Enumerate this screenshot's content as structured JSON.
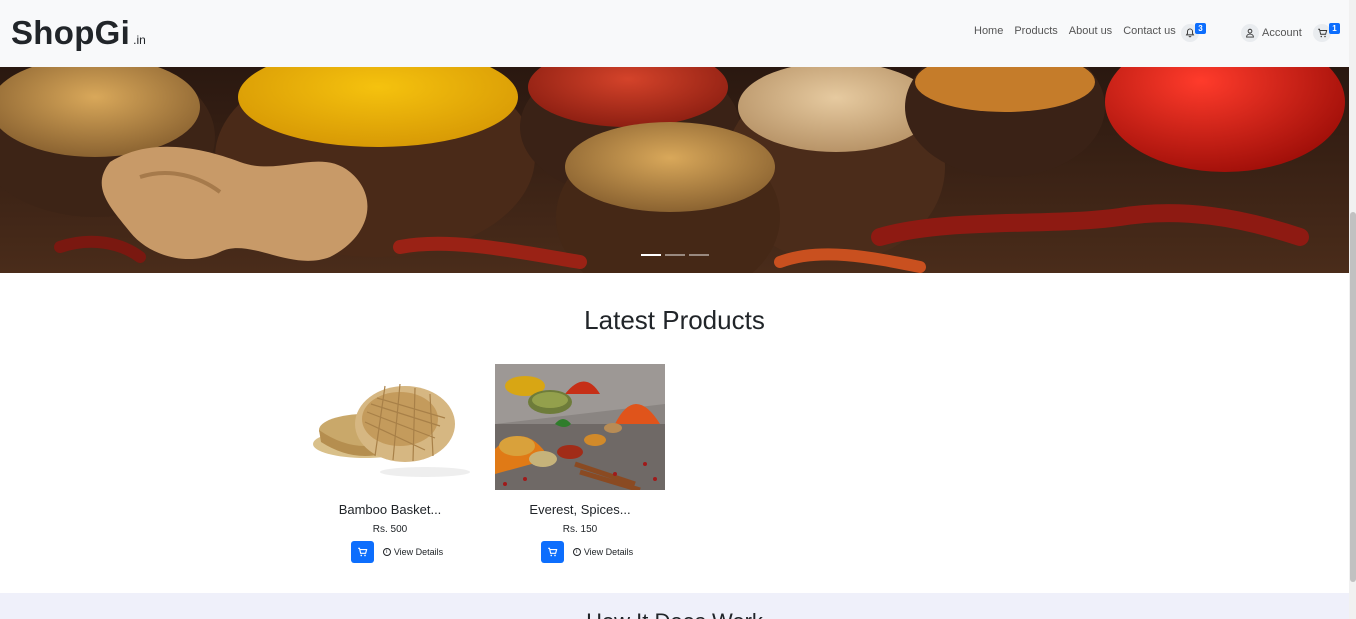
{
  "brand": {
    "name": "ShopGi",
    "suffix": ".in"
  },
  "nav": {
    "links": [
      "Home",
      "Products",
      "About us",
      "Contact us"
    ],
    "notifications_count": "3",
    "account_label": "Account",
    "cart_count": "1"
  },
  "hero": {
    "slides": 3,
    "active_slide": 1
  },
  "latest": {
    "title": "Latest Products",
    "products": [
      {
        "name": "Bamboo Basket...",
        "price": "Rs. 500",
        "details_label": "View Details"
      },
      {
        "name": "Everest, Spices...",
        "price": "Rs. 150",
        "details_label": "View Details"
      }
    ]
  },
  "how": {
    "title": "How It Does Work"
  },
  "colors": {
    "accent": "#0d6efd",
    "navbar": "#f8f9fa",
    "band": "#eff0fa"
  },
  "icons": [
    "bell-icon",
    "user-icon",
    "cart-icon",
    "info-icon"
  ]
}
